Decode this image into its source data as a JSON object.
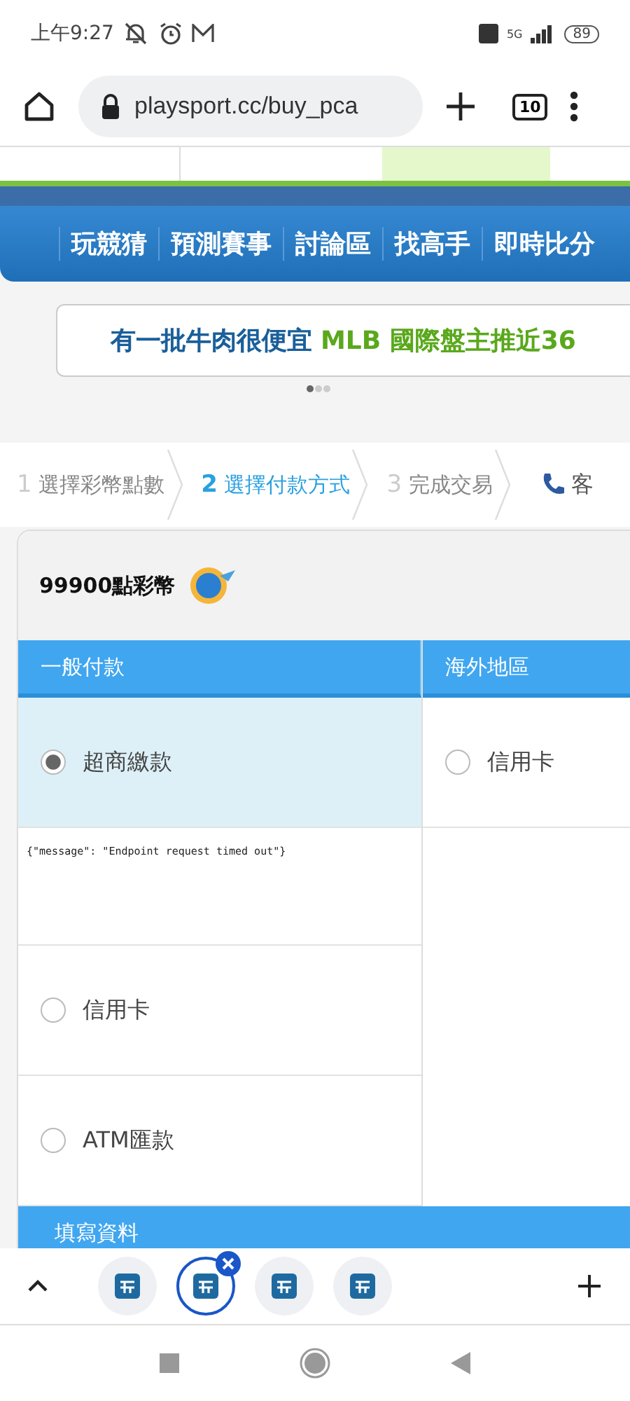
{
  "status_bar": {
    "time": "上午9:27",
    "network": "5G",
    "battery": "89"
  },
  "browser": {
    "url": "playsport.cc/buy_pca",
    "tab_count": "10"
  },
  "nav": {
    "items": [
      "玩競猜",
      "預測賽事",
      "討論區",
      "找高手",
      "即時比分"
    ]
  },
  "banner": {
    "text": "有一批牛肉很便宜",
    "highlight": "MLB 國際盤主推近36",
    "dots": [
      {
        "selected": true
      },
      {
        "selected": false
      },
      {
        "selected": false
      }
    ]
  },
  "steps": [
    {
      "number": "1",
      "label": "選擇彩幣點數",
      "selected": false
    },
    {
      "number": "2",
      "label": "選擇付款方式",
      "selected": true
    },
    {
      "number": "3",
      "label": "完成交易",
      "selected": false
    }
  ],
  "support": {
    "label": "客"
  },
  "card": {
    "title": "99900點彩幣",
    "columns": [
      {
        "heading": "一般付款",
        "rows": [
          {
            "kind": "option",
            "label": "超商繳款",
            "selected": true
          },
          {
            "kind": "message",
            "text": "{\"message\": \"Endpoint request timed out\"}"
          },
          {
            "kind": "option",
            "label": "信用卡",
            "selected": false
          },
          {
            "kind": "option",
            "label": "ATM匯款",
            "selected": false
          }
        ]
      },
      {
        "heading": "海外地區",
        "rows": [
          {
            "kind": "option",
            "label": "信用卡",
            "selected": false
          }
        ]
      }
    ],
    "section": "填寫資料"
  },
  "tab_strip": {
    "tabs": [
      {
        "selected": false
      },
      {
        "selected": true
      },
      {
        "selected": false
      },
      {
        "selected": false
      }
    ]
  }
}
